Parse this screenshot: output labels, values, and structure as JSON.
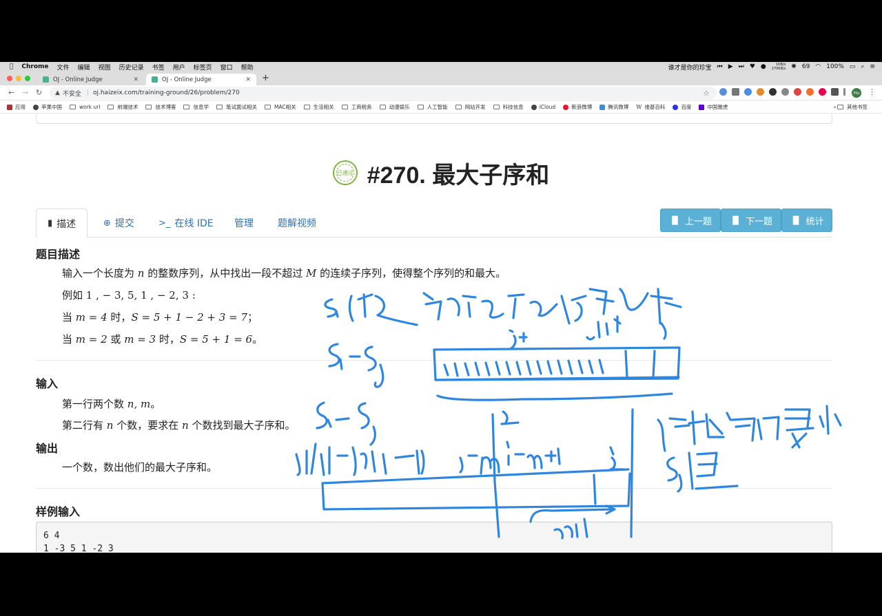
{
  "menubar": {
    "app": "Chrome",
    "items": [
      "文件",
      "编辑",
      "视图",
      "历史记录",
      "书签",
      "用户",
      "标签页",
      "窗口",
      "帮助"
    ],
    "now_playing": "谁才是你的珍宝",
    "net_up": "1KB/s",
    "net_down": "270KB/s",
    "temp": "69",
    "battery": "100%"
  },
  "tabs": [
    {
      "title": "OJ - Online Judge"
    },
    {
      "title": "OJ - Online Judge"
    }
  ],
  "address": {
    "security": "不安全",
    "url": "oj.haizeix.com/training-ground/26/problem/270"
  },
  "bookmarks": [
    "应用",
    "苹果中国",
    "work url",
    "前端技术",
    "技术博客",
    "信息学",
    "笔试面试相关",
    "MAC相关",
    "生活相关",
    "工商税务",
    "动漫娱乐",
    "人工智能",
    "网站开发",
    "科技信息",
    "iCloud",
    "新浪微博",
    "腾讯微博",
    "维基百科",
    "百度",
    "中国雅虎"
  ],
  "bookmarks_other": "其他书签",
  "avatar": "Hu",
  "problem": {
    "badge": "已通过",
    "title": "#270. 最大子序和",
    "tabs": [
      {
        "icon": "book-icon",
        "label": "描述"
      },
      {
        "icon": "upload-icon",
        "label": "提交"
      },
      {
        "icon": "terminal-icon",
        "label": "在线 IDE"
      },
      {
        "icon": "",
        "label": "管理"
      },
      {
        "icon": "",
        "label": "题解视频"
      }
    ],
    "buttons": [
      "上一题",
      "下一题",
      "统计"
    ],
    "desc_heading": "题目描述",
    "desc_line1_a": "输入一个长度为 ",
    "desc_line1_n": "n",
    "desc_line1_b": " 的整数序列，从中找出一段不超过 ",
    "desc_line1_M": "M",
    "desc_line1_c": " 的连续子序列，使得整个序列的和最大。",
    "example_label": "例如 ",
    "example_seq": "1 , − 3, 5, 1 , − 2, 3 :",
    "case1_a": "当 ",
    "case1_m": "m = 4",
    "case1_b": " 时，",
    "case1_expr": "S = 5 + 1 − 2 + 3 = 7",
    "case1_end": "；",
    "case2_a": "当 ",
    "case2_m1": "m = 2",
    "case2_or": " 或 ",
    "case2_m2": "m = 3",
    "case2_b": " 时，",
    "case2_expr": "S = 5 + 1 = 6",
    "case2_end": "。",
    "input_heading": "输入",
    "input_line1_a": "第一行两个数 ",
    "input_line1_vars": "n, m",
    "input_line1_b": "。",
    "input_line2_a": "第二行有 ",
    "input_line2_n1": "n",
    "input_line2_b": " 个数，要求在 ",
    "input_line2_n2": "n",
    "input_line2_c": " 个数找到最大子序和。",
    "output_heading": "输出",
    "output_line": "一个数，数出他们的最大子序和。",
    "sample_heading": "样例输入",
    "sample_lines": [
      "6 4",
      "1 -3 5 1 -2 3"
    ]
  },
  "annotations": [
    "Si 代表前 i 个元素的前缀和",
    "Si-Sj",
    "i+1",
    "j+1",
    "Si-Sj",
    "j∈[i-m+1, i-1]",
    "i-m",
    "i-m+1",
    "i",
    "维护窗口内最小",
    "Sj 值",
    "m"
  ]
}
